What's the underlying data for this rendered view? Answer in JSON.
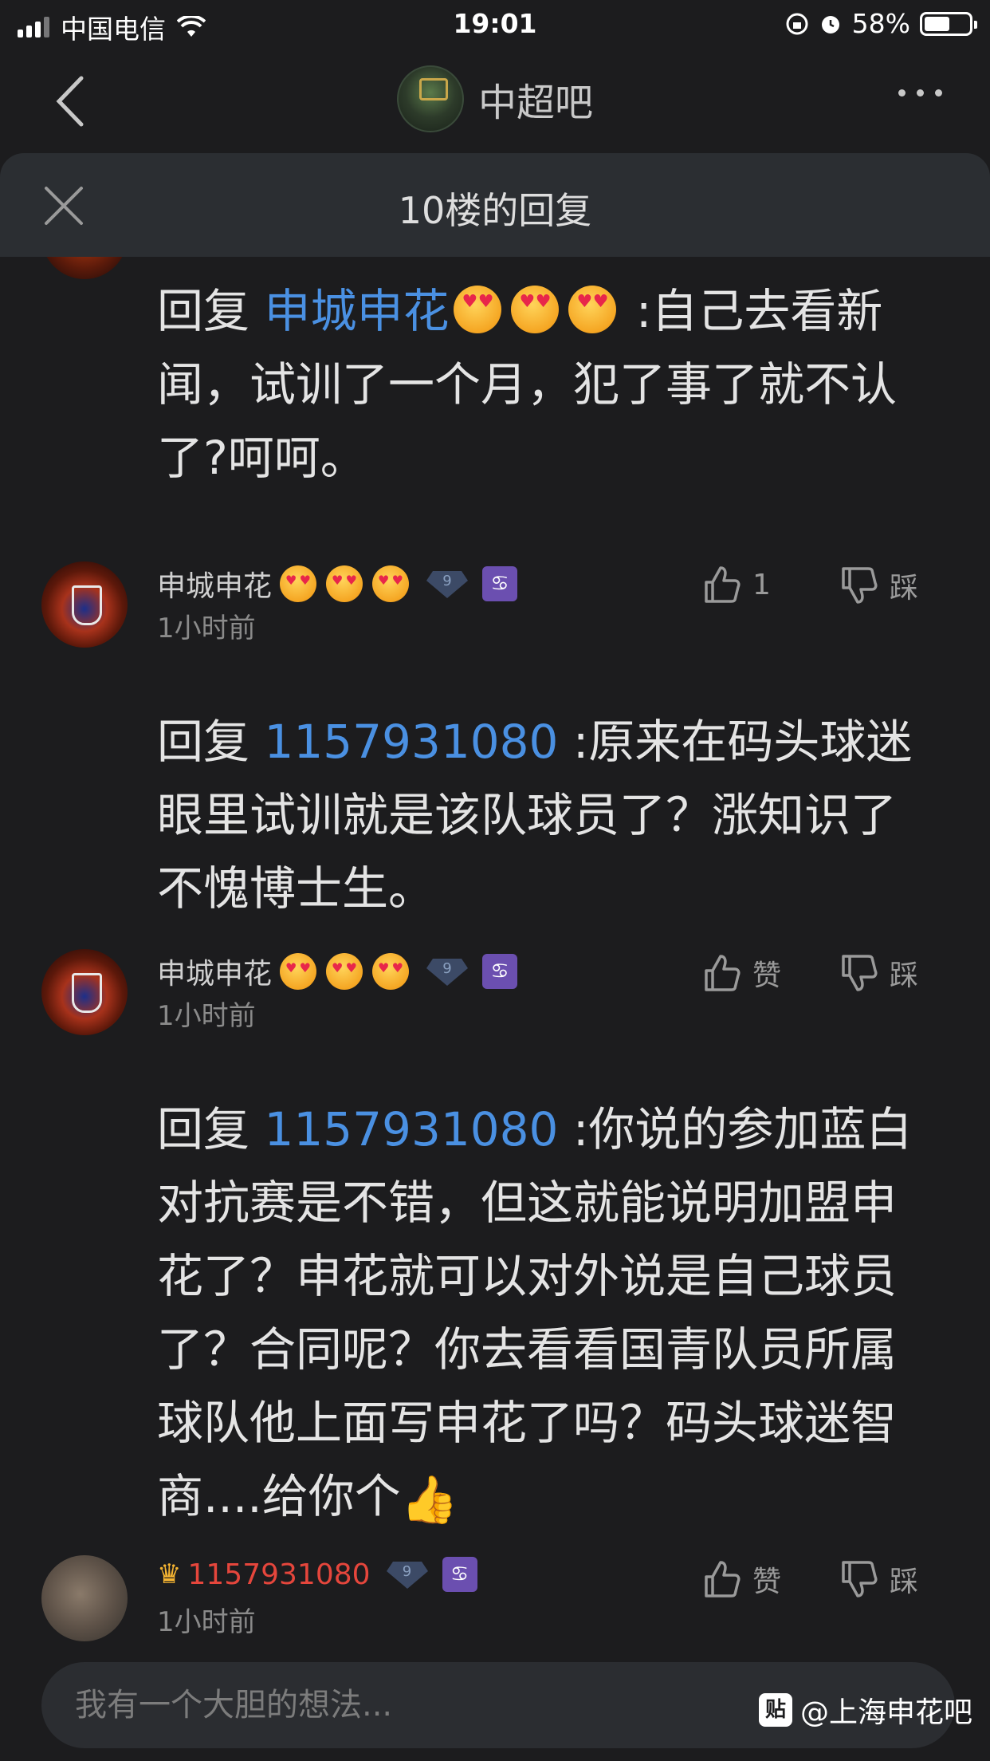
{
  "status_bar": {
    "carrier": "中国电信",
    "time": "19:01",
    "battery": "58%",
    "battery_level": 0.58
  },
  "nav": {
    "forum_name": "中超吧"
  },
  "sheet": {
    "title": "10楼的回复"
  },
  "first_reply": {
    "prefix": "回复 ",
    "mention": "申城申花",
    "text": " :自己去看新闻，试训了一个月，犯了事了就不认了?呵呵。"
  },
  "comments": [
    {
      "username": "申城申花",
      "level": "9",
      "sign_badge": "♋",
      "time": "1小时前",
      "like_label": "1",
      "dislike_label": "踩",
      "reply_prefix": "回复 ",
      "reply_mention": "1157931080",
      "reply_text": " :原来在码头球迷眼里试训就是该队球员了？涨知识了不愧博士生。"
    },
    {
      "username": "申城申花",
      "level": "9",
      "sign_badge": "♋",
      "time": "1小时前",
      "like_label": "赞",
      "dislike_label": "踩",
      "reply_prefix": "回复 ",
      "reply_mention": "1157931080",
      "reply_text": " :你说的参加蓝白对抗赛是不错，但这就能说明加盟申花了？申花就可以对外说是自己球员了？合同呢？你去看看国青队员所属球队他上面写申花了吗？码头球迷智商....给你个"
    },
    {
      "username": "1157931080",
      "level": "9",
      "sign_badge": "♋",
      "time": "1小时前",
      "like_label": "赞",
      "dislike_label": "踩"
    }
  ],
  "bottom": {
    "input_placeholder": "我有一个大胆的想法...",
    "watermark": "@上海申花吧",
    "watermark_logo": "贴"
  },
  "colors": {
    "background": "#1c1c1e",
    "mention": "#4a90e2",
    "vip_name": "#e5463c",
    "header": "#2b2e32"
  }
}
